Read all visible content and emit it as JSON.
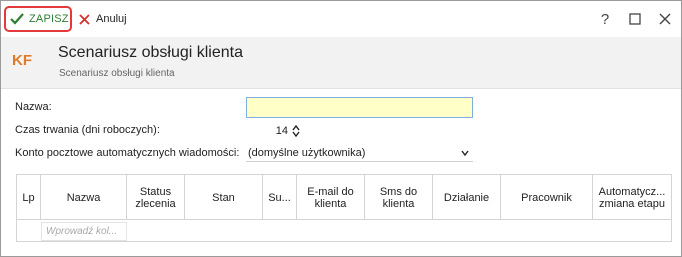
{
  "toolbar": {
    "save_label": "ZAPISZ",
    "cancel_label": "Anuluj",
    "help_label": "?"
  },
  "header": {
    "initials": "KF",
    "title": "Scenariusz obsługi klienta",
    "subtitle": "Scenariusz obsługi klienta"
  },
  "form": {
    "name_label": "Nazwa:",
    "name_value": "",
    "duration_label": "Czas trwania (dni roboczych):",
    "duration_value": "14",
    "mailbox_label": "Konto pocztowe automatycznych wiadomości:",
    "mailbox_value": "(domyślne użytkownika)"
  },
  "grid": {
    "columns": [
      "Lp",
      "Nazwa",
      "Status zlecenia",
      "Stan",
      "Su...",
      "E-mail do klienta",
      "Sms do klienta",
      "Działanie",
      "Pracownik",
      "Automatycz... zmiana etapu"
    ],
    "filter_placeholder": "Wprowadź kol..."
  },
  "colors": {
    "save_border": "#e23a3a",
    "save_text": "#2e7d32",
    "cancel_icon": "#d32f2f",
    "initials": "#e07b2a",
    "name_field_bg": "#ffffc8"
  },
  "icons": [
    "check-icon",
    "x-icon",
    "help-icon",
    "maximize-icon",
    "close-icon",
    "chevron-down-icon"
  ]
}
